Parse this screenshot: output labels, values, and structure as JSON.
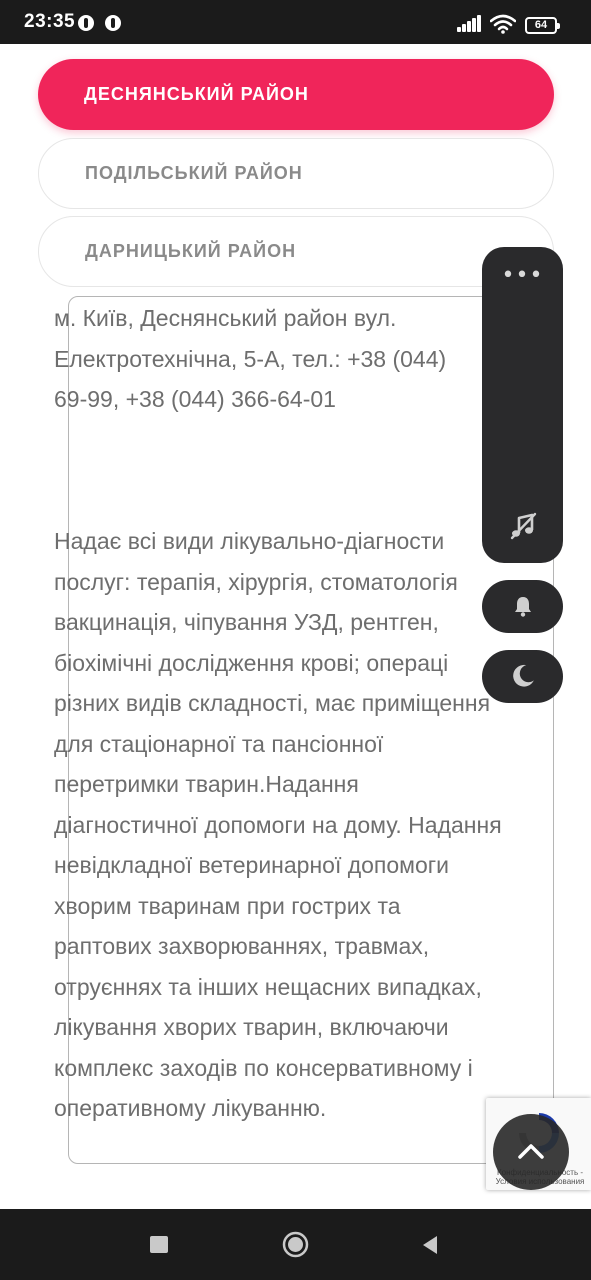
{
  "status_bar": {
    "time": "23:35",
    "battery": "64",
    "icons": [
      "pinterest-icon",
      "pinterest-icon",
      "signal-icon",
      "wifi-icon",
      "battery-icon"
    ]
  },
  "districts": [
    {
      "label": "ДЕСНЯНСЬКИЙ РАЙОН",
      "active": true
    },
    {
      "label": "ПОДІЛЬСЬКИЙ РАЙОН",
      "active": false
    },
    {
      "label": "ДАРНИЦЬКИЙ РАЙОН",
      "active": false
    }
  ],
  "content": {
    "address_lines": [
      "м. Київ, Деснянський район вул.",
      "Електротехнічна, 5-А, тел.:  +38 (044)",
      "69-99,  +38 (044) 366-64-01"
    ],
    "description_lines": [
      "Надає всі види лікувально-діагности",
      "послуг: терапія, хірургія, стоматологія",
      "вакцинація, чіпування УЗД, рентген,",
      "біохімічні дослідження крові; операці",
      "різних видів складності, має приміщення",
      "для стаціонарної та пансіонної",
      "перетримки тварин.Надання",
      "діагностичної допомоги на дому. Надання",
      "невідкладної ветеринарної допомоги",
      "хворим тваринам при гострих та",
      "раптових захворюваннях, травмах,",
      "отруєннях та інших нещасних випадках,",
      "лікування хворих тварин, включаючи",
      "комплекс заходів по консервативному і",
      "оперативному лікуванню."
    ]
  },
  "floating": {
    "menu_dots": "•••",
    "icons": [
      "music-off-icon",
      "bell-icon",
      "moon-icon"
    ]
  },
  "recaptcha": {
    "text": "Конфиденциальность - Условия использования"
  },
  "colors": {
    "accent": "#f0255a",
    "text": "#6e6e6e",
    "panel": "#2a2a2c"
  }
}
